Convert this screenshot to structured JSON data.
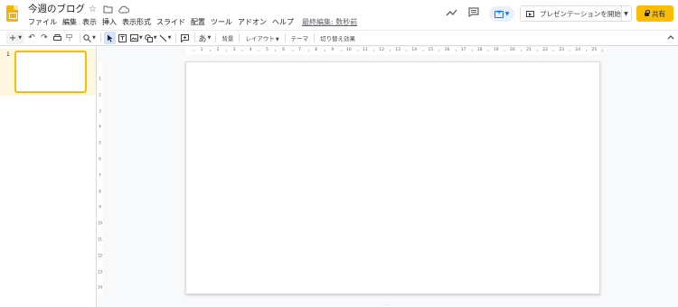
{
  "header": {
    "title": "今週のブログ",
    "title_icons": [
      "star-icon",
      "folder-move-icon",
      "cloud-status-icon"
    ],
    "menu": [
      "ファイル",
      "編集",
      "表示",
      "挿入",
      "表示形式",
      "スライド",
      "配置",
      "ツール",
      "アドオン",
      "ヘルプ"
    ],
    "last_edit": "最終編集: 数秒前",
    "present_label": "プレゼンテーションを開始",
    "share_label": "共有"
  },
  "toolbar": {
    "background": "背景",
    "layout": "レイアウト",
    "theme": "テーマ",
    "transition": "切り替え効果"
  },
  "filmstrip": {
    "slides": [
      {
        "number": "1"
      }
    ]
  },
  "ruler": {
    "horizontal": [
      "1",
      "2",
      "3",
      "4",
      "5",
      "6",
      "7",
      "8",
      "9",
      "10",
      "11",
      "12",
      "13",
      "14",
      "15",
      "16",
      "17",
      "18",
      "19",
      "20",
      "21",
      "22",
      "23",
      "24",
      "25"
    ],
    "vertical": [
      "1",
      "2",
      "3",
      "4",
      "5",
      "6",
      "7",
      "8",
      "9",
      "10",
      "11",
      "12",
      "13",
      "14"
    ]
  },
  "colors": {
    "accent": "#fbbc04",
    "logo": "#f4b400",
    "selection": "#fef7e0",
    "primary_blue": "#1a73e8"
  }
}
